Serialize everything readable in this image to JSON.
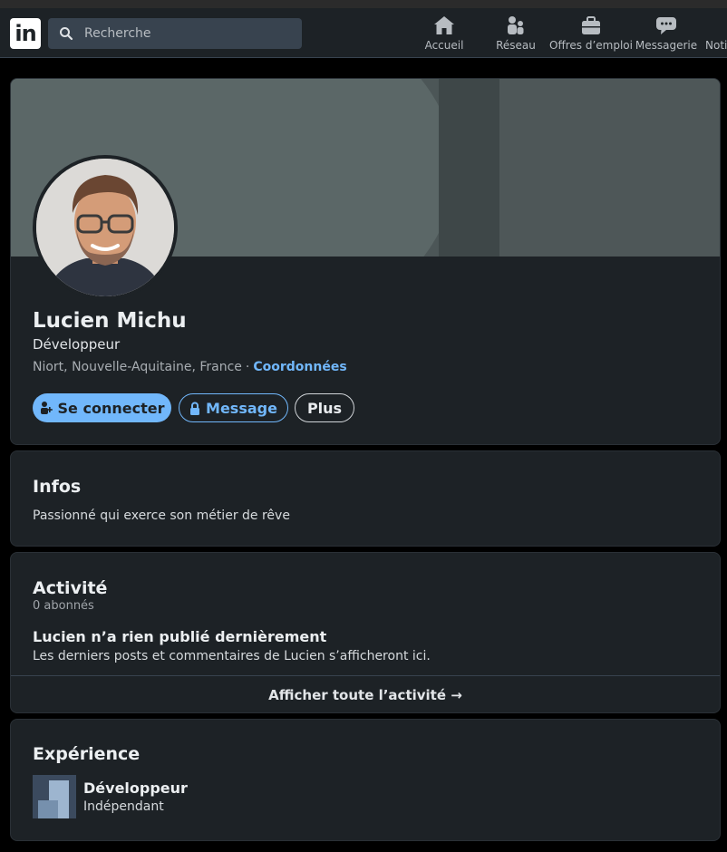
{
  "nav": {
    "search_placeholder": "Recherche",
    "items": [
      {
        "label": "Accueil",
        "icon": "home-icon"
      },
      {
        "label": "Réseau",
        "icon": "network-icon"
      },
      {
        "label": "Offres d’emploi",
        "icon": "briefcase-icon"
      },
      {
        "label": "Messagerie",
        "icon": "messaging-icon"
      },
      {
        "label": "Noti",
        "icon": "notifications-icon"
      }
    ]
  },
  "profile": {
    "name": "Lucien Michu",
    "headline": "Développeur",
    "location": "Niort, Nouvelle-Aquitaine, France",
    "separator": "·",
    "contact_label": "Coordonnées",
    "buttons": {
      "connect": "Se connecter",
      "message": "Message",
      "more": "Plus"
    }
  },
  "infos": {
    "title": "Infos",
    "text": "Passionné qui exerce son métier de rêve"
  },
  "activity": {
    "title": "Activité",
    "followers": "0 abonnés",
    "empty_title": "Lucien n’a rien publié dernièrement",
    "empty_text": "Les derniers posts et commentaires de Lucien s’afficheront ici.",
    "show_all": "Afficher toute l’activité →"
  },
  "experience": {
    "title": "Expérience",
    "role": "Développeur",
    "company": "Indépendant"
  },
  "colors": {
    "accent": "#71b7fb",
    "card_bg": "#1d2226",
    "page_bg": "#000000"
  }
}
